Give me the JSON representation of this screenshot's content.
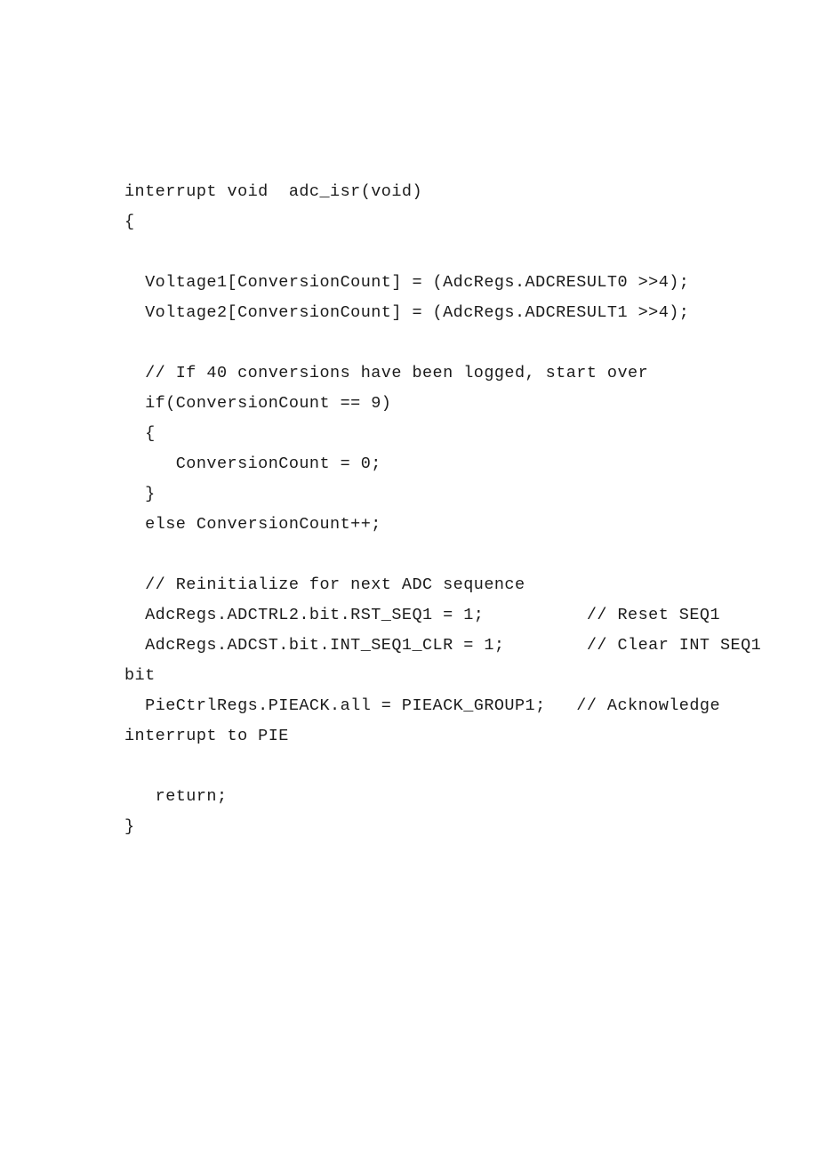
{
  "document": {
    "page_background": "#ffffff",
    "text_color": "#1b1b1b",
    "title": "adc_isr source listing"
  },
  "code": {
    "language": "c",
    "lines": [
      {
        "id": "line-1",
        "text": "interrupt void  adc_isr(void)"
      },
      {
        "id": "line-2",
        "text": "{"
      },
      {
        "id": "line-3",
        "text": ""
      },
      {
        "id": "line-4",
        "text": "  Voltage1[ConversionCount] = (AdcRegs.ADCRESULT0 >>4);"
      },
      {
        "id": "line-5",
        "text": "  Voltage2[ConversionCount] = (AdcRegs.ADCRESULT1 >>4);"
      },
      {
        "id": "line-6",
        "text": ""
      },
      {
        "id": "line-7",
        "text": "  // If 40 conversions have been logged, start over"
      },
      {
        "id": "line-8",
        "text": "  if(ConversionCount == 9)"
      },
      {
        "id": "line-9",
        "text": "  {"
      },
      {
        "id": "line-10",
        "text": "     ConversionCount = 0;"
      },
      {
        "id": "line-11",
        "text": "  }"
      },
      {
        "id": "line-12",
        "text": "  else ConversionCount++;"
      },
      {
        "id": "line-13",
        "text": ""
      },
      {
        "id": "line-14",
        "text": "  // Reinitialize for next ADC sequence"
      },
      {
        "id": "line-15",
        "text": "  AdcRegs.ADCTRL2.bit.RST_SEQ1 = 1;          // Reset SEQ1"
      },
      {
        "id": "line-16",
        "text": "  AdcRegs.ADCST.bit.INT_SEQ1_CLR = 1;        // Clear INT SEQ1"
      },
      {
        "id": "line-17",
        "text": "bit"
      },
      {
        "id": "line-18",
        "text": "  PieCtrlRegs.PIEACK.all = PIEACK_GROUP1;   // Acknowledge"
      },
      {
        "id": "line-19",
        "text": "interrupt to PIE"
      },
      {
        "id": "line-20",
        "text": ""
      },
      {
        "id": "line-21",
        "text": "   return;"
      },
      {
        "id": "line-22",
        "text": "}"
      }
    ]
  }
}
